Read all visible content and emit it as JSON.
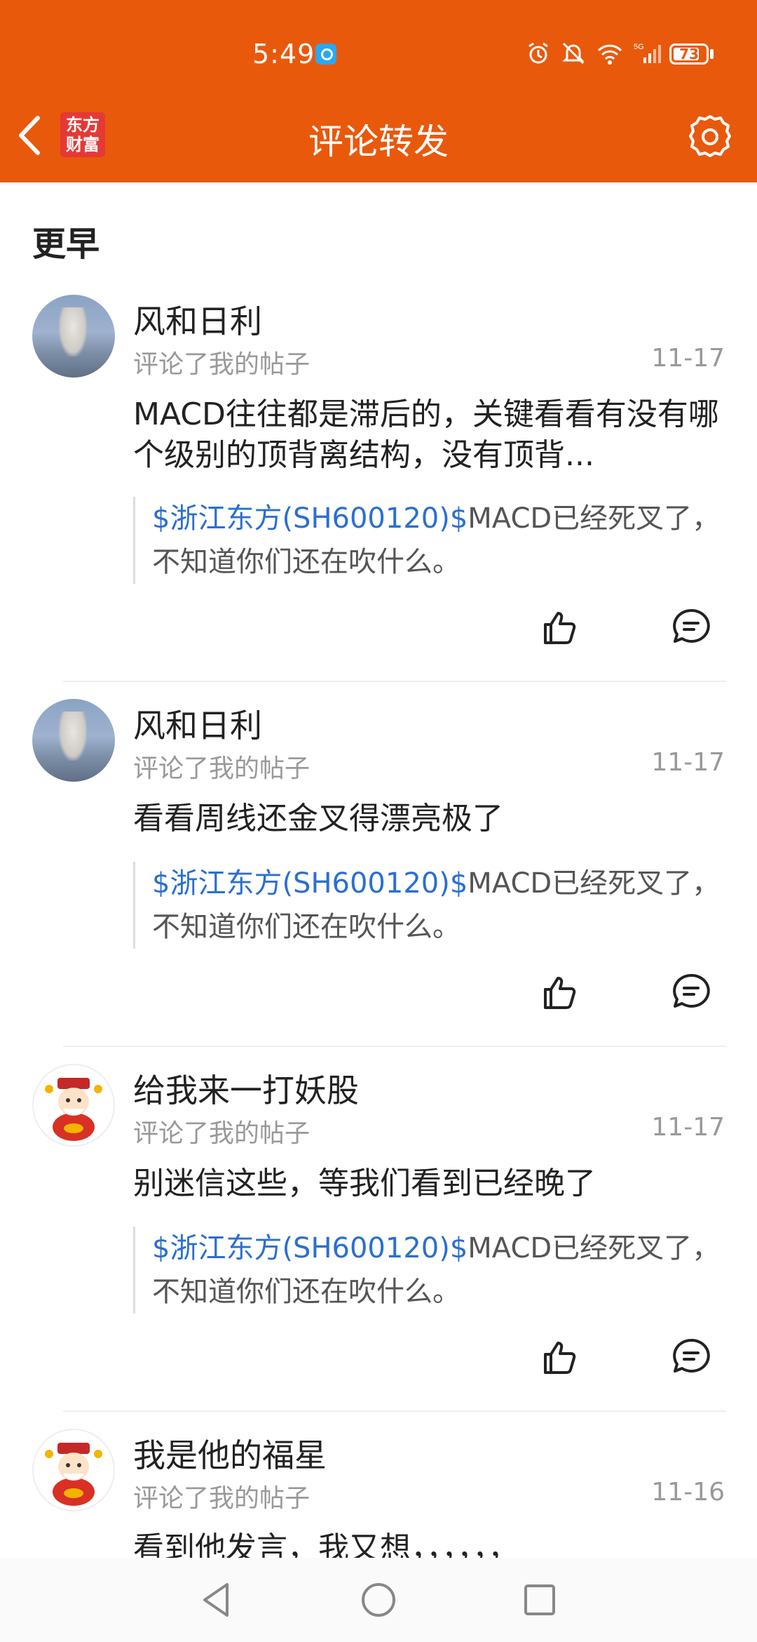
{
  "status_bar": {
    "time": "5:49",
    "battery": "73"
  },
  "header": {
    "title": "评论转发",
    "logo_text": "东方财富"
  },
  "section": {
    "title": "更早"
  },
  "items": [
    {
      "name": "风和日利",
      "action": "评论了我的帖子",
      "date": "11-17",
      "comment": "MACD往往都是滞后的，关键看看有没有哪个级别的顶背离结构，没有顶背...",
      "quote_link": "$浙江东方(SH600120)$",
      "quote_text": "MACD已经死叉了，不知道你们还在吹什么。"
    },
    {
      "name": "风和日利",
      "action": "评论了我的帖子",
      "date": "11-17",
      "comment": "看看周线还金叉得漂亮极了",
      "quote_link": "$浙江东方(SH600120)$",
      "quote_text": "MACD已经死叉了，不知道你们还在吹什么。"
    },
    {
      "name": "给我来一打妖股",
      "action": "评论了我的帖子",
      "date": "11-17",
      "comment": "别迷信这些，等我们看到已经晚了",
      "quote_link": "$浙江东方(SH600120)$",
      "quote_text": "MACD已经死叉了，不知道你们还在吹什么。"
    },
    {
      "name": "我是他的福星",
      "action": "评论了我的帖子",
      "date": "11-16",
      "comment": "看到他发言，我又想，，，，，，"
    }
  ]
}
